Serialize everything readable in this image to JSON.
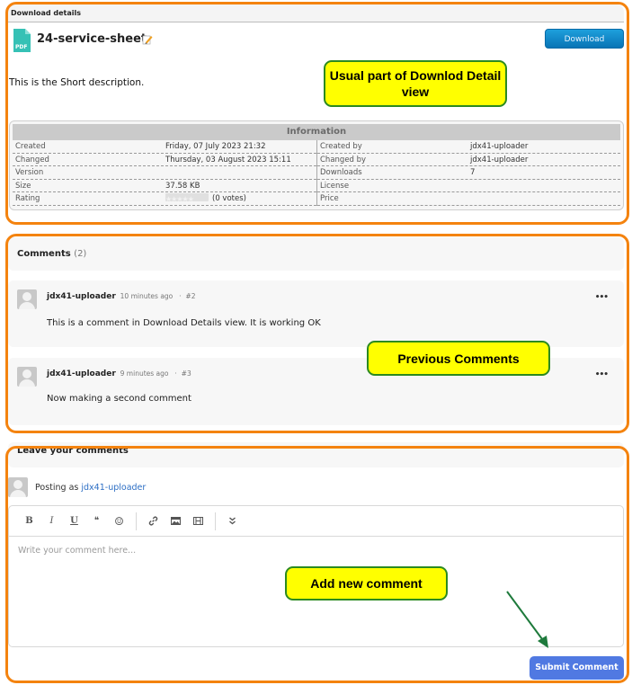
{
  "download_details": {
    "section_header": "Download details",
    "title": "24-service-sheet",
    "file_type": "PDF",
    "download_label": "Download",
    "short_description": "This is the Short description.",
    "information": {
      "heading": "Information",
      "left": [
        {
          "label": "Created",
          "value": "Friday, 07 July 2023 21:32"
        },
        {
          "label": "Changed",
          "value": "Thursday, 03 August 2023 15:11"
        },
        {
          "label": "Version",
          "value": ""
        },
        {
          "label": "Size",
          "value": "37.58 KB"
        },
        {
          "label": "Rating",
          "value": "(0 votes)",
          "stars_filled": 0,
          "stars_total": 5
        }
      ],
      "right": [
        {
          "label": "Created by",
          "value": "jdx41-uploader"
        },
        {
          "label": "Changed by",
          "value": "jdx41-uploader"
        },
        {
          "label": "Downloads",
          "value": "7"
        },
        {
          "label": "License",
          "value": ""
        },
        {
          "label": "Price",
          "value": ""
        }
      ]
    }
  },
  "comments": {
    "heading": "Comments",
    "count": "(2)",
    "items": [
      {
        "author": "jdx41-uploader",
        "time": "10 minutes ago",
        "dot": "·",
        "number": "#2",
        "text": "This is a comment in Download Details view. It is working OK",
        "more": "•••"
      },
      {
        "author": "jdx41-uploader",
        "time": "9 minutes ago",
        "dot": "·",
        "number": "#3",
        "text": "Now making a second comment",
        "more": "•••"
      }
    ]
  },
  "leave_comment": {
    "heading": "Leave your comments",
    "posting_as_label": "Posting as",
    "posting_as_user": "jdx41-uploader",
    "toolbar": [
      {
        "name": "bold",
        "glyph": "B"
      },
      {
        "name": "italic",
        "glyph": "I"
      },
      {
        "name": "underline",
        "glyph": "U"
      },
      {
        "name": "quote",
        "glyph": "❝"
      },
      {
        "name": "emoji",
        "glyph": "☺"
      },
      {
        "name": "link",
        "glyph": "🔗"
      },
      {
        "name": "image",
        "glyph": "▣"
      },
      {
        "name": "video",
        "glyph": "▤"
      },
      {
        "name": "more",
        "glyph": "⌄"
      }
    ],
    "placeholder": "Write your comment here...",
    "submit_label": "Submit Comment"
  },
  "annotations": {
    "callout1": "Usual part of Downlod Detail view",
    "callout2": "Previous Comments",
    "callout3": "Add new comment"
  },
  "colors": {
    "frame": "#f4830f",
    "callout_fill": "#ffff00",
    "callout_border": "#2c8a20",
    "download_btn": "#0a86c8",
    "submit_btn": "#5079e2",
    "link": "#2c6ec4"
  }
}
